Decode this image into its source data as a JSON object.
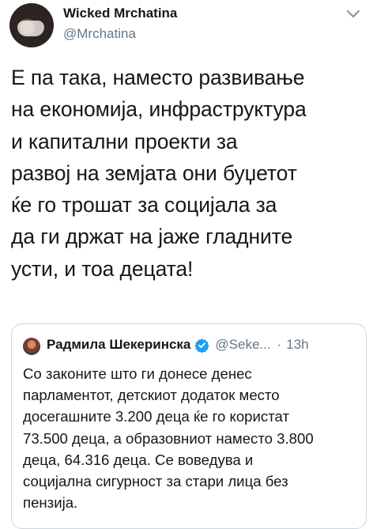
{
  "author": {
    "display_name": "Wicked Mrchatina",
    "handle": "@Mrchatina"
  },
  "tweet": {
    "text": "Е па така, наместо развивање\nна економија, инфраструктура\nи капитални проекти за\nразвој на земјата они буџетот\nќе го трошат за социјала за\nда ги држат на јаже гладните\nусти, и тоа децата!"
  },
  "quoted_tweet": {
    "display_name": "Радмила Шекеринска",
    "handle": "@Seke...",
    "separator": "·",
    "time": "13h",
    "text": "Со законите што ги донесе денес\nпарламентот, детскиот додаток место\nдосегашните 3.200 деца ќе го користат\n73.500 деца, а образовниот наместо 3.800\nдеца, 64.316 деца. Се воведува и\nсоцијална сигурност за стари лица без\nпензија."
  },
  "icons": {
    "menu": "chevron-down-icon",
    "verified": "verified-badge-icon"
  },
  "colors": {
    "text_primary": "#14171a",
    "text_secondary": "#657786",
    "verified_blue": "#1da1f2",
    "border": "#ccd6dd"
  }
}
